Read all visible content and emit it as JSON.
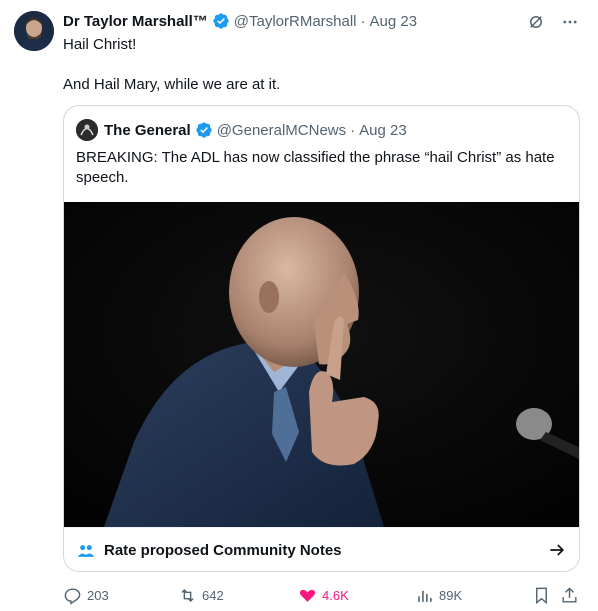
{
  "post": {
    "author_name": "Dr Taylor Marshall™",
    "handle": "@TaylorRMarshall",
    "separator": "·",
    "date": "Aug 23",
    "text_line1": "Hail Christ!",
    "text_line2": "And Hail Mary, while we are at it."
  },
  "quoted": {
    "author_name": "The General",
    "handle": "@GeneralMCNews",
    "separator": "·",
    "date": "Aug 23",
    "text": "BREAKING: The ADL has now classified the phrase “hail Christ” as hate speech."
  },
  "community_notes": {
    "label": "Rate proposed Community Notes"
  },
  "actions": {
    "replies": "203",
    "reposts": "642",
    "likes": "4.6K",
    "views": "89K"
  },
  "colors": {
    "verified": "#1d9bf0",
    "like": "#f91880",
    "muted": "#536471",
    "border": "#cfd9de"
  }
}
